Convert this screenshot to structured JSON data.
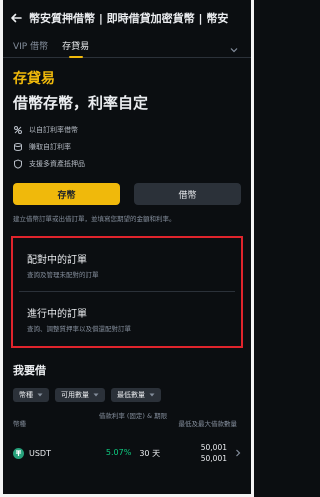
{
  "header": {
    "title": "幣安質押借幣 | 即時借貸加密貨幣 | 幣安"
  },
  "tabs": [
    {
      "label": "VIP 借幣"
    },
    {
      "label": "存貸易"
    }
  ],
  "hero": {
    "brand": "存貸易",
    "tagline": "借幣存幣，利率自定",
    "features": [
      {
        "icon": "percent-icon",
        "text": "以自訂利率借幣"
      },
      {
        "icon": "coin-stack-icon",
        "text": "賺取自訂利率"
      },
      {
        "icon": "shield-icon",
        "text": "支援多資產抵押品"
      }
    ]
  },
  "actions": {
    "deposit_label": "存幣",
    "borrow_label": "借幣"
  },
  "hint": "建立借幣訂單或出借訂單，並填寫您期望的金額和利率。",
  "orders": [
    {
      "title": "配對中的訂單",
      "subtitle": "查詢及管理未配對的訂單"
    },
    {
      "title": "進行中的訂單",
      "subtitle": "查詢、調整質押率以及償還配對訂單"
    }
  ],
  "borrow_section": {
    "title": "我要借",
    "filters": [
      "幣種",
      "可用數量",
      "最低數量"
    ],
    "columns": {
      "asset": "幣種",
      "rate": "借款利率 (固定) & 期限",
      "amount": "最低及最大借款數量"
    },
    "rows": [
      {
        "asset": "USDT",
        "rate": "5.07%",
        "term": "30 天",
        "min_amount": "50,001",
        "max_amount": "50,001"
      }
    ]
  },
  "colors": {
    "accent": "#f0b90b",
    "positive": "#0ecb81",
    "highlight_border": "#e0242c"
  }
}
